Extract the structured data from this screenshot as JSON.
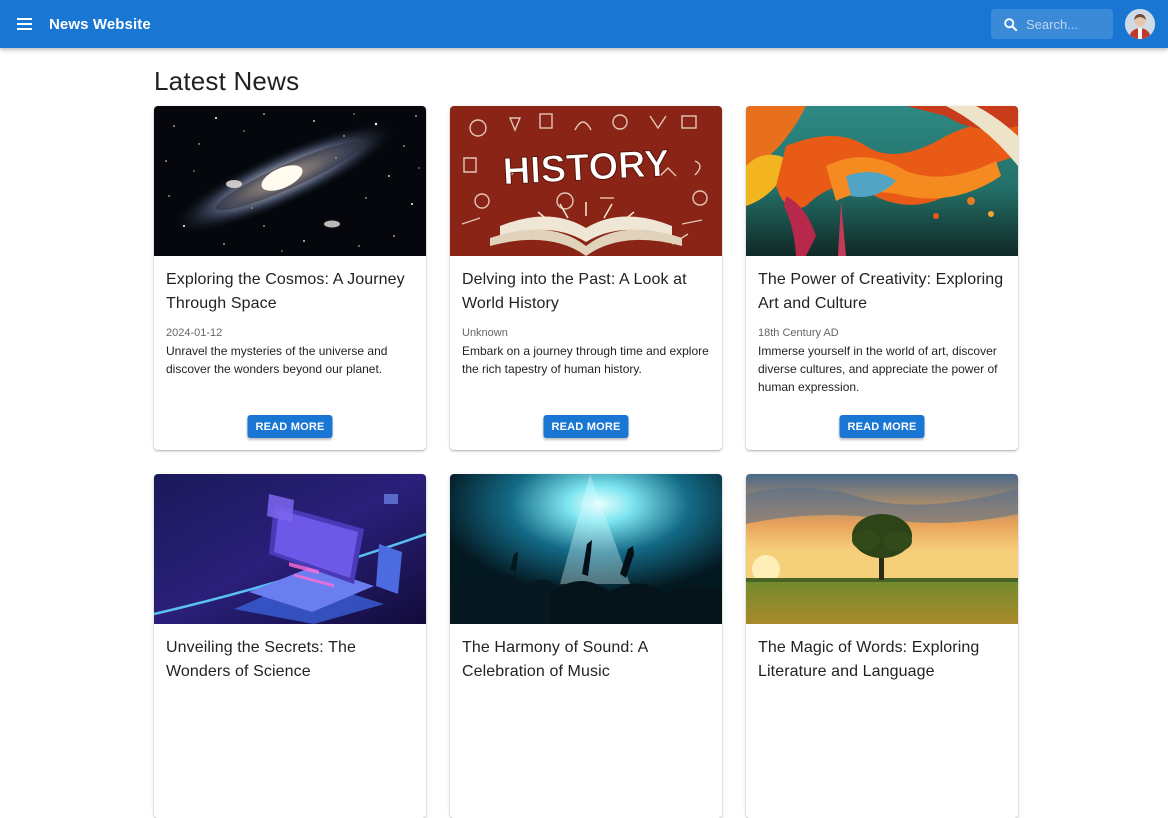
{
  "header": {
    "brand": "News Website",
    "search_placeholder": "Search...",
    "menu_icon": "hamburger-menu-icon",
    "search_icon": "magnifier-search-icon",
    "avatar_icon": "user-avatar"
  },
  "colors": {
    "appbar": "#1976d2",
    "button": "#1976d2"
  },
  "page": {
    "title": "Latest News"
  },
  "articles": [
    {
      "title": "Exploring the Cosmos: A Journey Through Space",
      "date": "2024-01-12",
      "description": "Unravel the mysteries of the universe and discover the wonders beyond our planet.",
      "button": "READ MORE",
      "image": "galaxy-image"
    },
    {
      "title": "Delving into the Past: A Look at World History",
      "date": "Unknown",
      "description": "Embark on a journey through time and explore the rich tapestry of human history.",
      "button": "READ MORE",
      "image": "history-book-image"
    },
    {
      "title": "The Power of Creativity: Exploring Art and Culture",
      "date": "18th Century AD",
      "description": "Immerse yourself in the world of art, discover diverse cultures, and appreciate the power of human expression.",
      "button": "READ MORE",
      "image": "paint-splash-image"
    },
    {
      "title": "Unveiling the Secrets: The Wonders of Science",
      "date": "",
      "description": "",
      "button": "",
      "image": "laptop-technology-image"
    },
    {
      "title": "The Harmony of Sound: A Celebration of Music",
      "date": "",
      "description": "",
      "button": "",
      "image": "concert-crowd-image"
    },
    {
      "title": "The Magic of Words: Exploring Literature and Language",
      "date": "",
      "description": "",
      "button": "",
      "image": "tree-sunset-image"
    }
  ]
}
